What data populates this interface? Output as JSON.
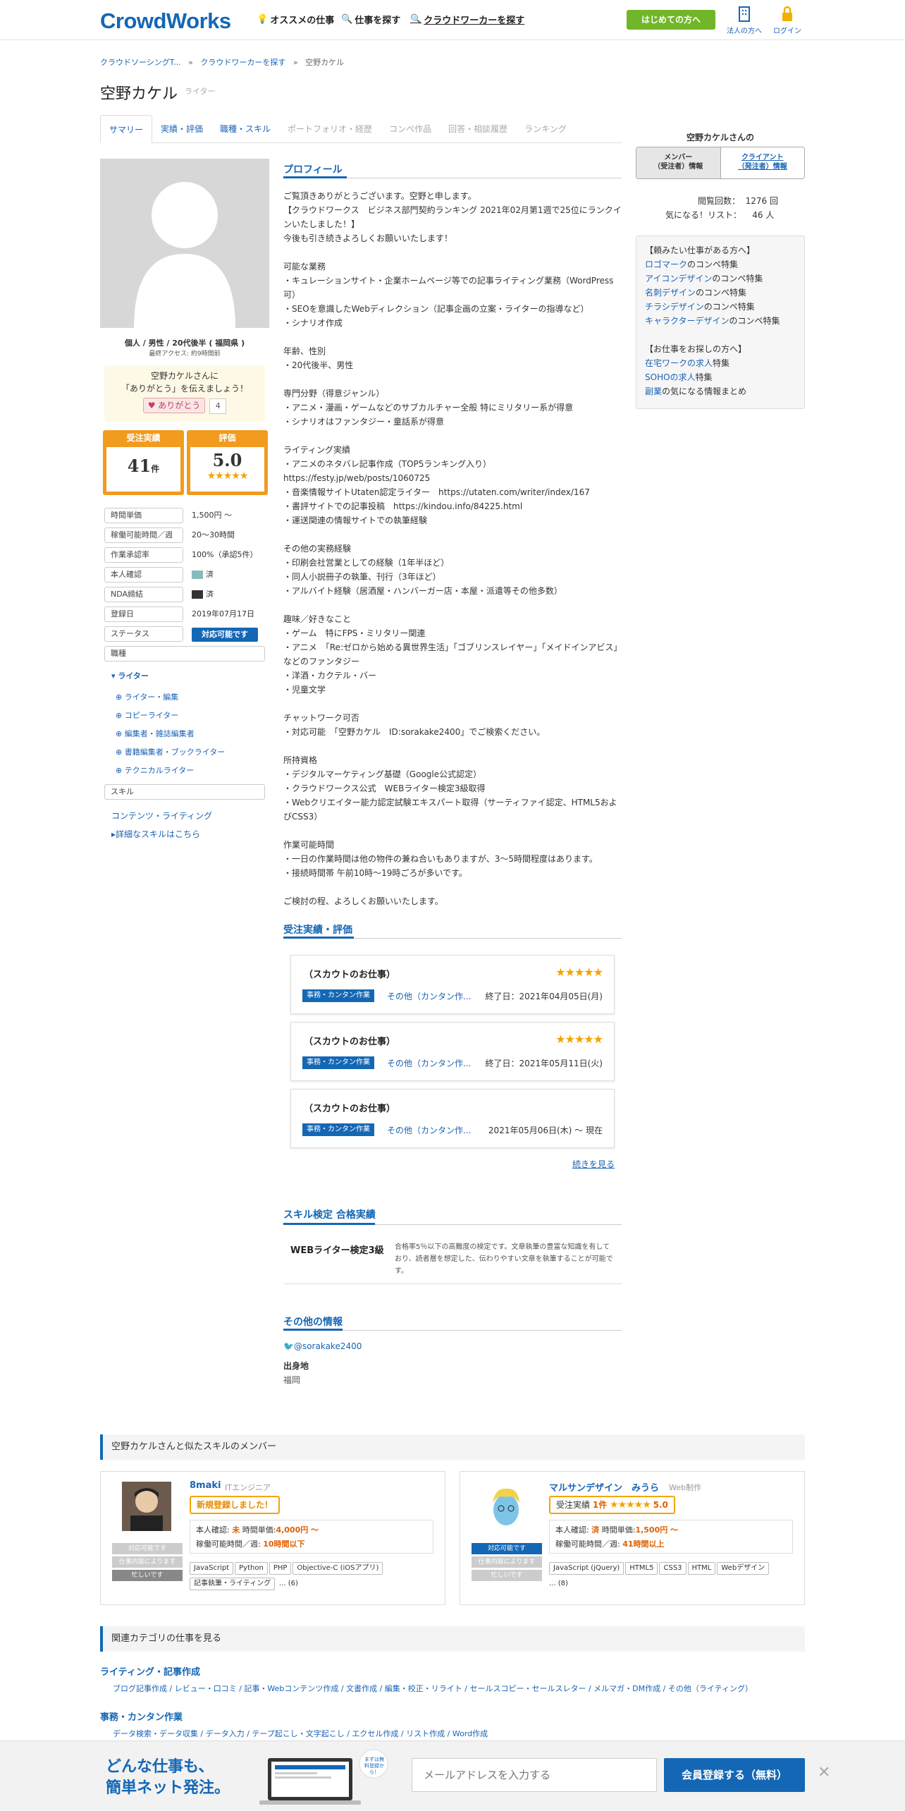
{
  "header": {
    "logo": "CrowdWorks",
    "nav": [
      "オススメの仕事",
      "仕事を探す",
      "クラウドワーカーを探す"
    ],
    "first_btn": "はじめての方へ",
    "corp": "法人の方へ",
    "login": "ログイン"
  },
  "breadcrumb": [
    "クラウドソーシングT...",
    "クラウドワーカーを探す",
    "空野カケル"
  ],
  "page": {
    "title": "空野カケル",
    "subtitle": "ライター"
  },
  "tabs": [
    "サマリー",
    "実績・評価",
    "職種・スキル",
    "ポートフォリオ・経歴",
    "コンペ作品",
    "回答・相談履歴",
    "ランキング"
  ],
  "profile_card": {
    "type": "個人 / 男性 / 20代後半 ( 福岡県 )",
    "last_access": "最終アクセス: 約9時間前",
    "thanks_line1": "空野カケルさんに",
    "thanks_line2": "「ありがとう」を伝えましょう！",
    "thanks_btn": "ありがとう",
    "thanks_count": "4",
    "orders_label": "受注実績",
    "orders_value": "41",
    "orders_unit": "件",
    "rating_label": "評価",
    "rating_value": "5.0",
    "stars": "★★★★★"
  },
  "info": [
    {
      "k": "時間単価",
      "v": "1,500円 〜"
    },
    {
      "k": "稼働可能時間／週",
      "v": "20〜30時間"
    },
    {
      "k": "作業承認率",
      "v": "100%（承認5件）"
    },
    {
      "k": "本人確認",
      "v": "済"
    },
    {
      "k": "NDA締結",
      "v": "済"
    },
    {
      "k": "登録日",
      "v": "2019年07月17日"
    },
    {
      "k": "ステータス",
      "v": "対応可能です"
    }
  ],
  "jobs_box": "職種",
  "jobs": {
    "main": "ライター",
    "subs": [
      "ライター・編集",
      "コピーライター",
      "編集者・雑誌編集者",
      "書籍編集者・ブックライター",
      "テクニカルライター"
    ]
  },
  "skills_box": "スキル",
  "skill_link": "コンテンツ・ライティング",
  "skill_detail": "詳細なスキルはこちら",
  "profile": {
    "heading": "プロフィール",
    "text": "ご覧頂きありがとうございます。空野と申します。\n【クラウドワークス　ビジネス部門契約ランキング 2021年02月第1週で25位にランクインいたしました！】\n今後も引き続きよろしくお願いいたします！\n\n可能な業務\n・キュレーションサイト・企業ホームページ等での記事ライティング業務（WordPress可）\n・SEOを意識したWebディレクション（記事企画の立案・ライターの指導など）\n・シナリオ作成\n\n年齢、性別\n・20代後半、男性\n\n専門分野（得意ジャンル）\n・アニメ・漫画・ゲームなどのサブカルチャー全般 特にミリタリー系が得意\n・シナリオはファンタジー・童話系が得意\n\nライティング実績\n・アニメのネタバレ記事作成（TOP5ランキング入り）https://festy.jp/web/posts/1060725\n・音楽情報サイトUtaten認定ライター　https://utaten.com/writer/index/167\n・書評サイトでの記事投稿　https://kindou.info/84225.html\n・運送関連の情報サイトでの執筆経験\n\nその他の実務経験\n・印刷会社営業としての経験（1年半ほど）\n・同人小説冊子の執筆、刊行（3年ほど）\n・アルバイト経験（居酒屋・ハンバーガー店・本屋・派遣等その他多数）\n\n趣味／好きなこと\n・ゲーム　特にFPS・ミリタリー関連\n・アニメ　「Re:ゼロから始める異世界生活」「ゴブリンスレイヤー」「メイドインアビス」などのファンタジー\n・洋酒・カクテル・バー\n・児童文学\n\nチャットワーク可否\n・対応可能　「空野カケル　ID:sorakake2400」でご検索ください。\n\n所持資格\n・デジタルマーケティング基礎（Google公式認定）\n・クラウドワークス公式　WEBライター検定3級取得\n・Webクリエイター能力認定試験エキスパート取得（サーティファイ認定、HTML5およびCSS3）\n\n作業可能時間\n・一日の作業時間は他の物件の兼ね合いもありますが、3～5時間程度はあります。\n・接続時間帯 午前10時～19時ごろが多いです。\n\nご検討の程、よろしくお願いいたします。"
  },
  "orders": {
    "heading": "受注実績・評価",
    "items": [
      {
        "title": "（スカウトのお仕事）",
        "stars": "★★★★★",
        "cat": "事務・カンタン作業",
        "sub": "その他（カンタン作...",
        "date": "終了日：2021年04月05日(月)"
      },
      {
        "title": "（スカウトのお仕事）",
        "stars": "★★★★★",
        "cat": "事務・カンタン作業",
        "sub": "その他（カンタン作...",
        "date": "終了日：2021年05月11日(火)"
      },
      {
        "title": "（スカウトのお仕事）",
        "stars": "",
        "cat": "事務・カンタン作業",
        "sub": "その他（カンタン作...",
        "date": "2021年05月06日(木) 〜 現在"
      }
    ],
    "more": "続きを見る"
  },
  "skilltest": {
    "heading": "スキル検定 合格実績",
    "name": "WEBライター検定3級",
    "desc": "合格率5％以下の高難度の検定です。文章執筆の豊富な知識を有しており、読者層を想定した、伝わりやすい文章を執筆することが可能です。"
  },
  "other": {
    "heading": "その他の情報",
    "twitter": "@sorakake2400",
    "origin_label": "出身地",
    "origin": "福岡"
  },
  "right": {
    "title": "空野カケルさんの",
    "tab1": "メンバー\n（受注者）情報",
    "tab2": "クライアント\n（発注者）情報",
    "views_label": "閲覧回数：",
    "views": "1276 回",
    "fav_label": "気になる！リスト：",
    "fav": "46 人",
    "box1_head": "【頼みたい仕事がある方へ】",
    "box1": [
      [
        "ロゴマーク",
        "のコンペ特集"
      ],
      [
        "アイコンデザイン",
        "のコンペ特集"
      ],
      [
        "名刺デザイン",
        "のコンペ特集"
      ],
      [
        "チラシデザイン",
        "のコンペ特集"
      ],
      [
        "キャラクターデザイン",
        "のコンペ特集"
      ]
    ],
    "box2_head": "【お仕事をお探しの方へ】",
    "box2": [
      [
        "在宅ワークの求人",
        "特集"
      ],
      [
        "SOHOの求人",
        "特集"
      ],
      [
        "副業",
        "の気になる情報まとめ"
      ]
    ]
  },
  "similar": {
    "heading": "空野カケルさんと似たスキルのメンバー",
    "m1": {
      "name": "8maki",
      "role": "ITエンジニア",
      "badge": "新規登録しました！",
      "id_label": "本人確認:",
      "id": "未",
      "rate_label": "時間単価:",
      "rate": "4,000円 〜",
      "hours_label": "稼働可能時間／週:",
      "hours": "10時間以下",
      "st1": "対応可能です",
      "st2": "仕事内容によります",
      "st3": "忙しいです",
      "tags": [
        "JavaScript",
        "Python",
        "PHP",
        "Objective-C (iOSアプリ)",
        "記事執筆・ライティング"
      ],
      "more": "... (6)"
    },
    "m2": {
      "name": "マルサンデザイン　みうら",
      "role": "Web制作",
      "badge_pre": "受注実績",
      "badge_cnt": "1件",
      "badge_stars": "★★★★★",
      "badge_rate": "5.0",
      "id_label": "本人確認:",
      "id": "済",
      "rate_label": "時間単価:",
      "rate": "1,500円 〜",
      "hours_label": "稼働可能時間／週:",
      "hours": "41時間以上",
      "st1": "対応可能です",
      "st2": "仕事内容によります",
      "st3": "忙しいです",
      "tags": [
        "JavaScript (jQuery)",
        "HTML5",
        "CSS3",
        "HTML",
        "Webデザイン"
      ],
      "more": "... (8)"
    }
  },
  "related": {
    "heading": "関連カテゴリの仕事を見る",
    "c1": "ライティング・記事作成",
    "c1_links": "ブログ記事作成 / レビュー・口コミ / 記事・Webコンテンツ作成 / 文書作成 / 編集・校正・リライト / セールスコピー・セールスレター / メルマガ・DM作成 / その他（ライティング）",
    "c2": "事務・カンタン作業",
    "c2_links": "データ検索・データ収集 / データ入力 / テープ起こし・文字起こし / エクセル作成 / リスト作成 / Word作成"
  },
  "footer": {
    "l1": "どんな仕事も、",
    "l2": "簡単ネット発注。",
    "bubble": "まずは無料登録から！",
    "placeholder": "メールアドレスを入力する",
    "btn": "会員登録する（無料）"
  }
}
